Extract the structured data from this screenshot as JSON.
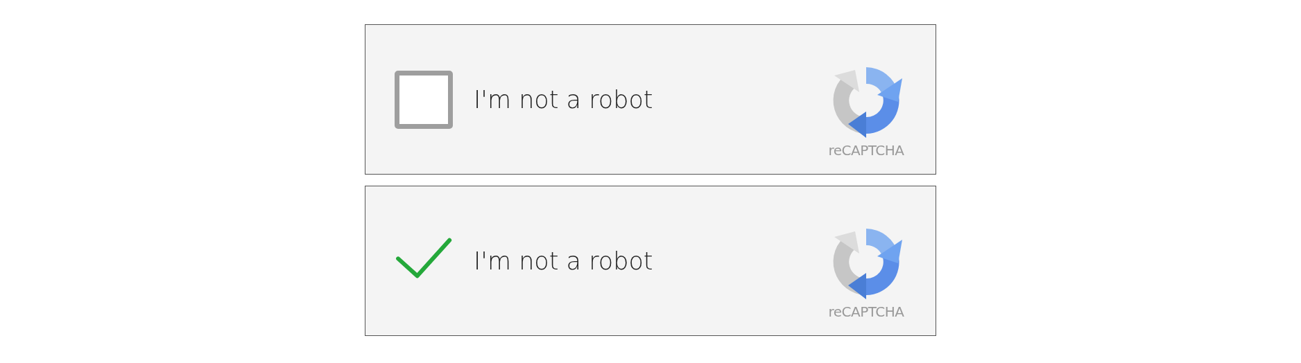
{
  "widgets": [
    {
      "checked": false,
      "label": "I'm not a robot",
      "brand": "reCAPTCHA"
    },
    {
      "checked": true,
      "label": "I'm not a robot",
      "brand": "reCAPTCHA"
    }
  ]
}
